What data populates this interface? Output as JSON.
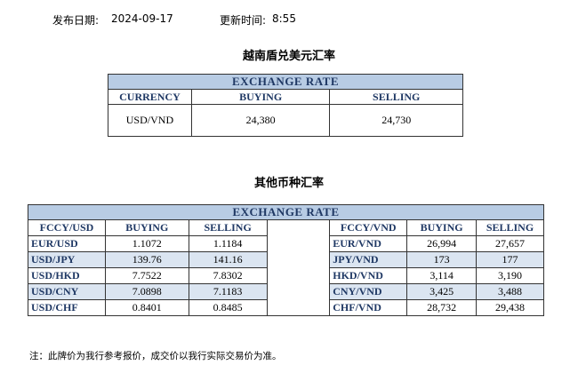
{
  "header": {
    "publish_date_label": "发布日期:",
    "publish_date": "2024-09-17",
    "update_time_label": "更新时间:",
    "update_time": "8:55"
  },
  "vnd_section": {
    "title": "越南盾兑美元汇率",
    "table_title": "EXCHANGE RATE",
    "columns": [
      "CURRENCY",
      "BUYING",
      "SELLING"
    ],
    "row": {
      "currency": "USD/VND",
      "buying": "24,380",
      "selling": "24,730"
    }
  },
  "other_section": {
    "title": "其他币种汇率",
    "table_title": "EXCHANGE  RATE",
    "left_columns": [
      "FCCY/USD",
      "BUYING",
      "SELLING"
    ],
    "right_columns": [
      "FCCY/VND",
      "BUYING",
      "SELLING"
    ],
    "rows": [
      {
        "left_code": "EUR/USD",
        "left_buy": "1.1072",
        "left_sell": "1.1184",
        "right_code": "EUR/VND",
        "right_buy": "26,994",
        "right_sell": "27,657"
      },
      {
        "left_code": "USD/JPY",
        "left_buy": "139.76",
        "left_sell": "141.16",
        "right_code": "JPY/VND",
        "right_buy": "173",
        "right_sell": "177"
      },
      {
        "left_code": "USD/HKD",
        "left_buy": "7.7522",
        "left_sell": "7.8302",
        "right_code": "HKD/VND",
        "right_buy": "3,114",
        "right_sell": "3,190"
      },
      {
        "left_code": "USD/CNY",
        "left_buy": "7.0898",
        "left_sell": "7.1183",
        "right_code": "CNY/VND",
        "right_buy": "3,425",
        "right_sell": "3,488"
      },
      {
        "left_code": "USD/CHF",
        "left_buy": "0.8401",
        "left_sell": "0.8485",
        "right_code": "CHF/VND",
        "right_buy": "28,732",
        "right_sell": "29,438"
      }
    ]
  },
  "footnote": "注：此牌价为我行参考报价，成交价以我行实际交易价为准。",
  "colors": {
    "header_fill": "#b8cce4",
    "alt_row_fill": "#dbe5f1",
    "heading_text": "#1f3864"
  }
}
